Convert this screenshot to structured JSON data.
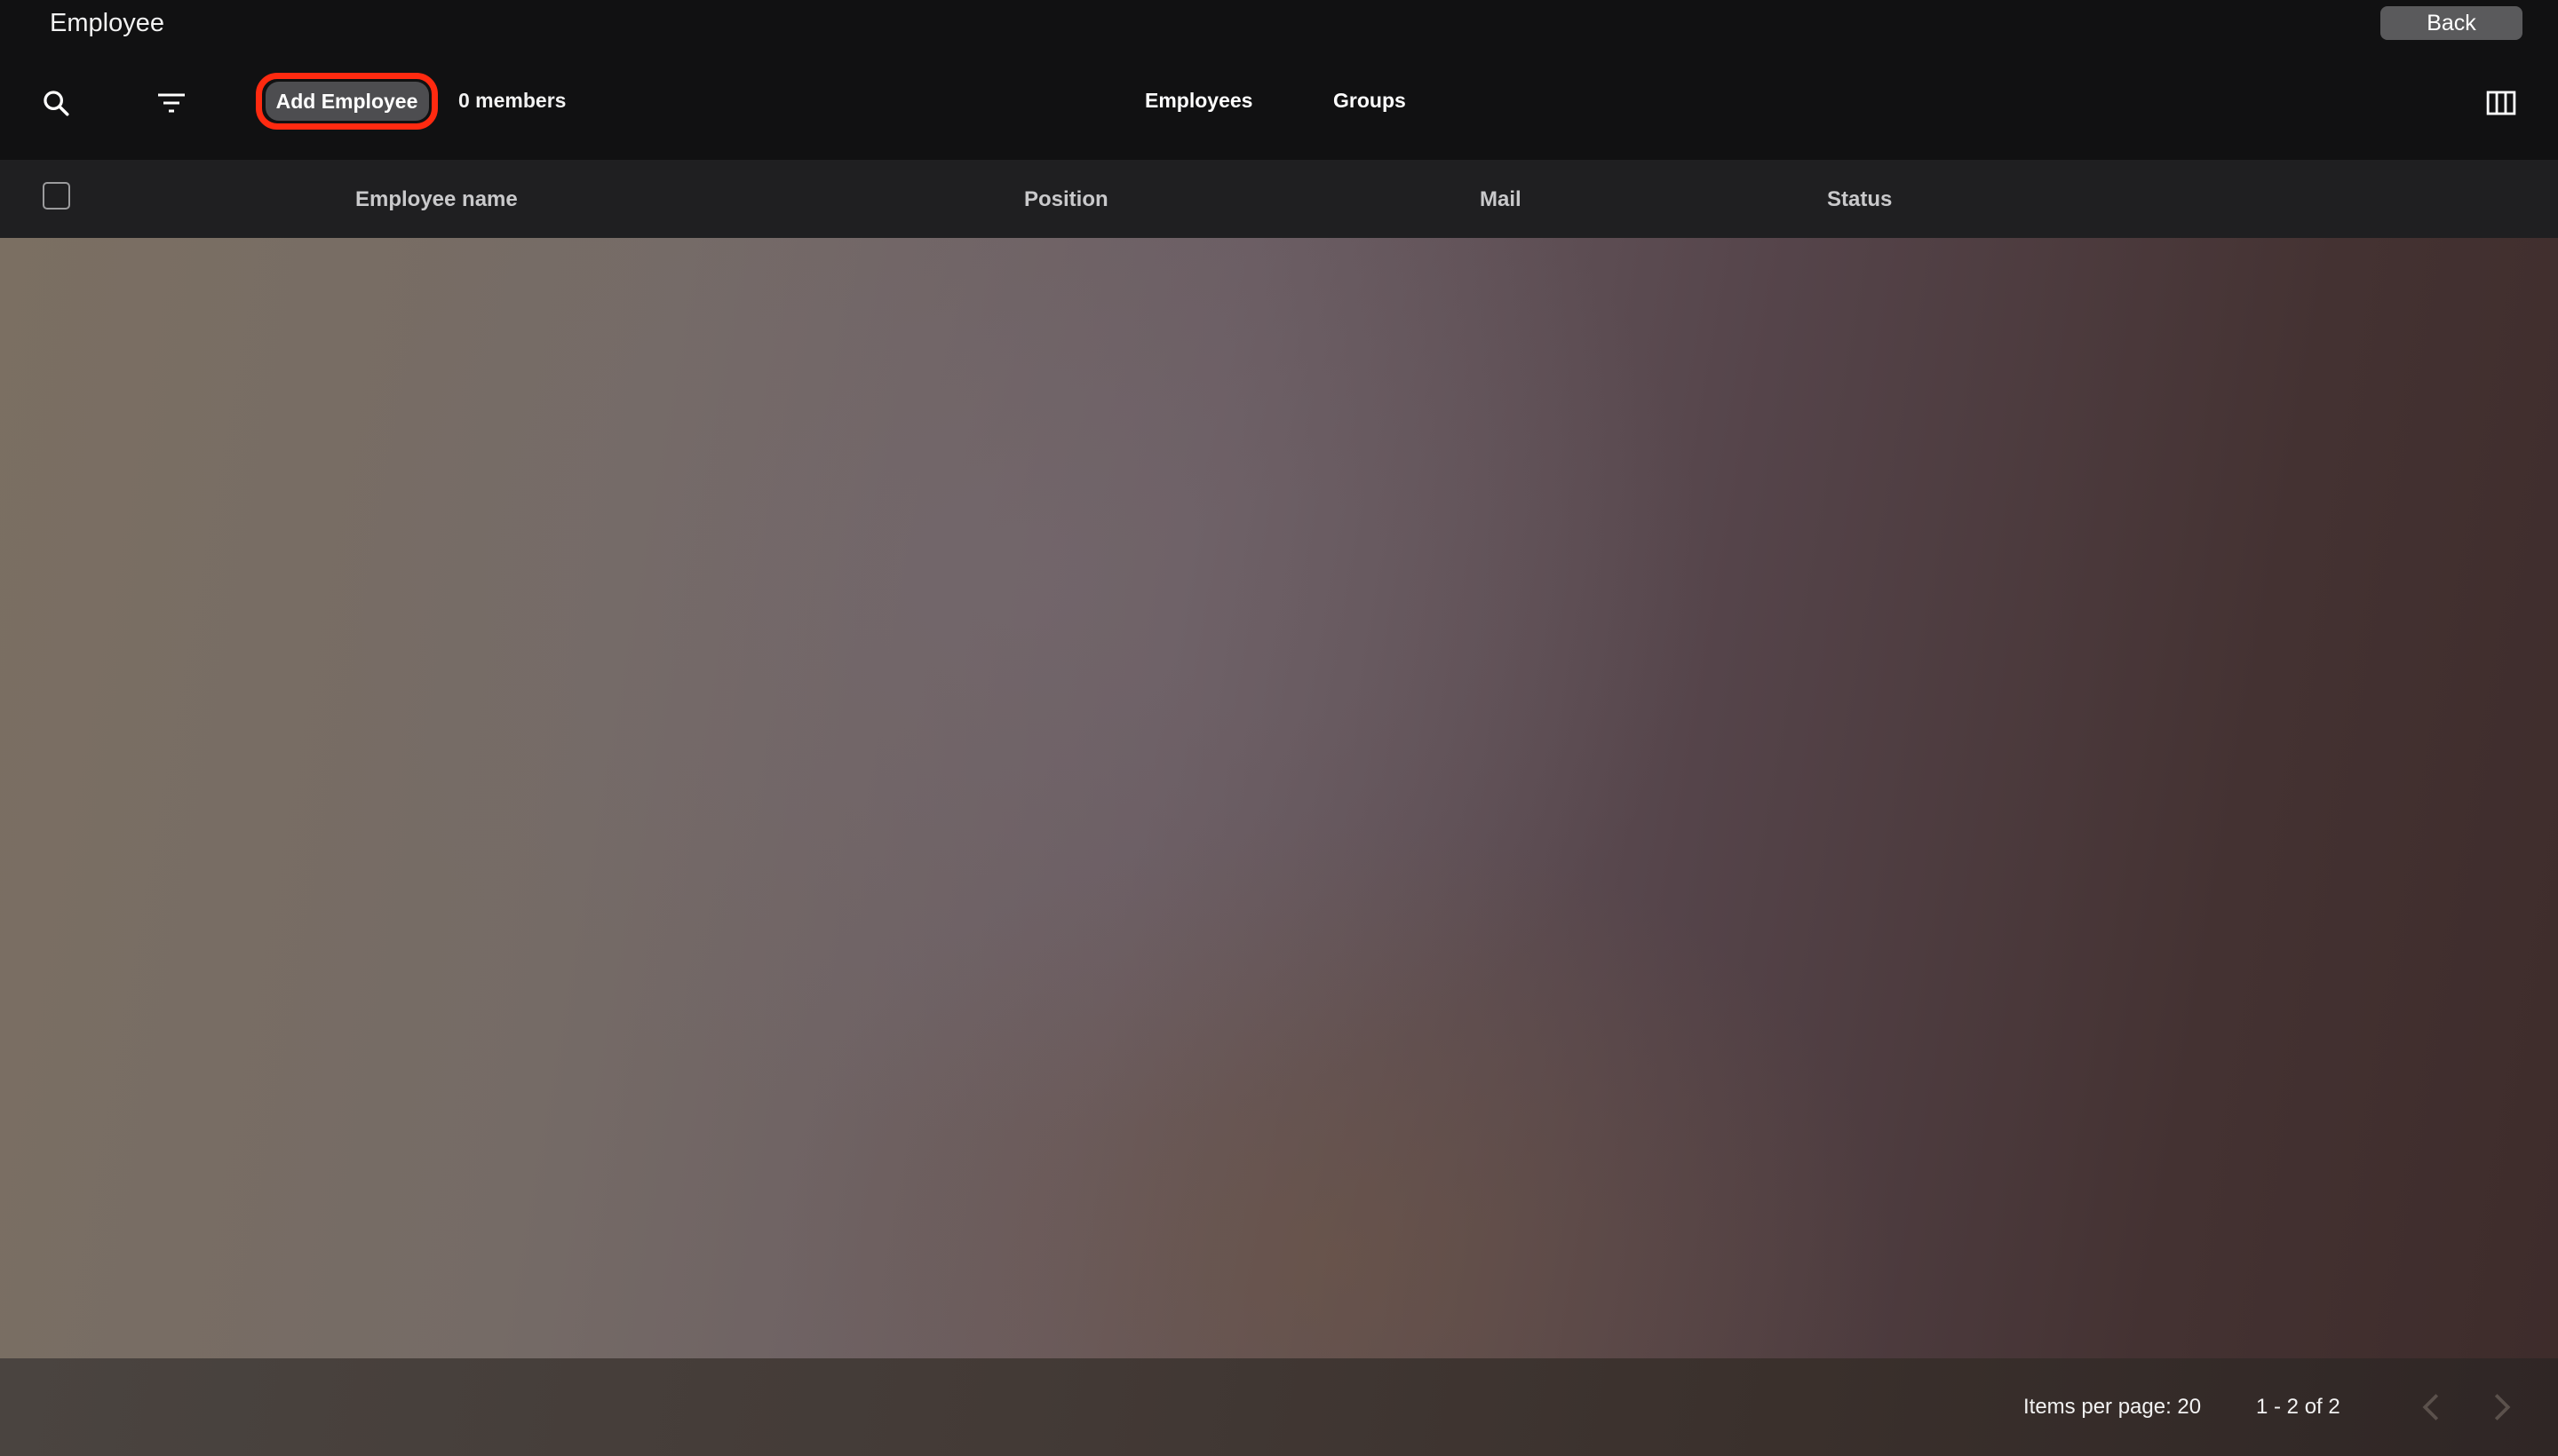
{
  "header": {
    "title": "Employee",
    "back_label": "Back"
  },
  "toolbar": {
    "search_icon": "search-icon",
    "filter_icon": "filter-icon",
    "add_label": "Add Employee",
    "members_count": "0 members",
    "tabs": [
      {
        "label": "Employees"
      },
      {
        "label": "Groups"
      }
    ],
    "columns_icon": "view-columns-icon"
  },
  "table": {
    "columns": [
      "Employee name",
      "Position",
      "Mail",
      "Status"
    ]
  },
  "paginator": {
    "items_per_page": "Items per page: 20",
    "range": "1 - 2 of 2"
  },
  "colors": {
    "highlight": "#ff2a10",
    "background": "#111112"
  }
}
